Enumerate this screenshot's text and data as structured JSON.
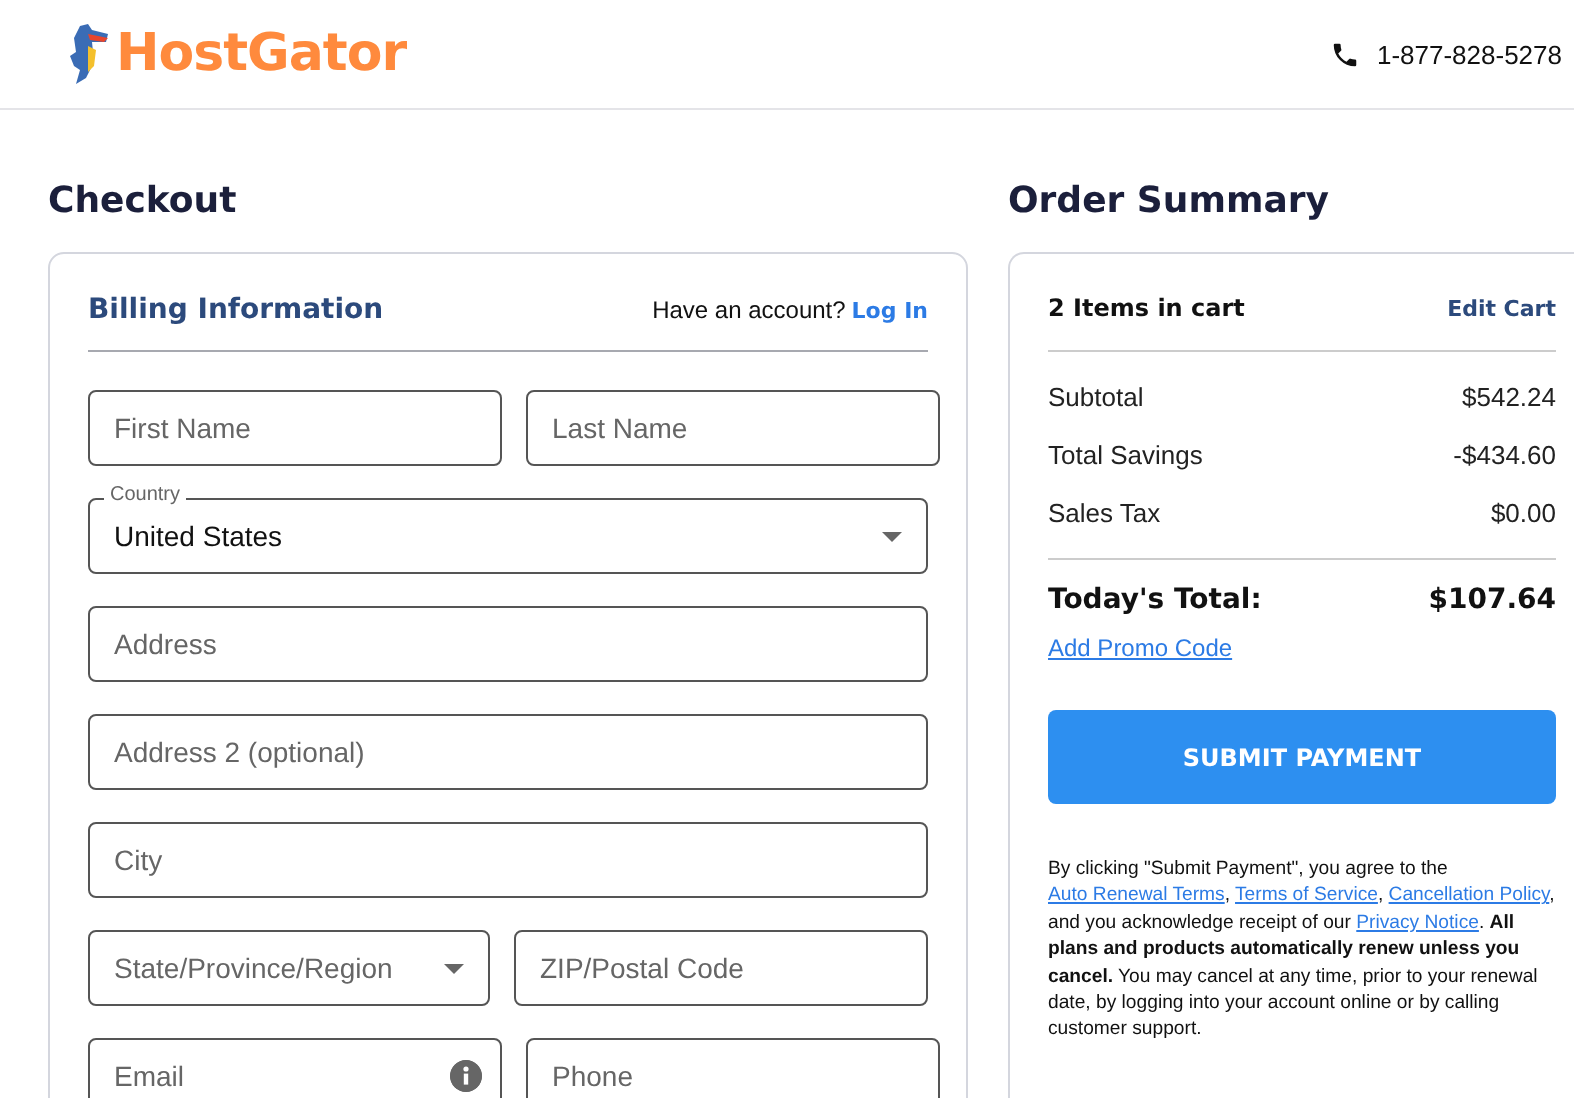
{
  "header": {
    "logo": "HostGator",
    "phone": "1-877-828-5278"
  },
  "checkout": {
    "title": "Checkout",
    "billing_title": "Billing Information",
    "account_prompt": "Have an account?",
    "login_link": "Log In",
    "field_rows": [
      [
        {
          "kind": "text",
          "placeholder": "First Name"
        },
        {
          "kind": "text",
          "placeholder": "Last Name"
        }
      ],
      [
        {
          "kind": "select",
          "label": "Country",
          "value": "United States"
        }
      ],
      [
        {
          "kind": "text",
          "placeholder": "Address"
        }
      ],
      [
        {
          "kind": "text",
          "placeholder": "Address 2 (optional)"
        }
      ],
      [
        {
          "kind": "text",
          "placeholder": "City"
        }
      ],
      [
        {
          "kind": "select",
          "placeholder": "State/Province/Region"
        },
        {
          "kind": "text",
          "placeholder": "ZIP/Postal Code"
        }
      ],
      [
        {
          "kind": "info",
          "placeholder": "Email"
        },
        {
          "kind": "text",
          "placeholder": "Phone"
        }
      ]
    ]
  },
  "order_summary": {
    "title": "Order Summary",
    "items_in_cart": "2 Items in cart",
    "edit_cart": "Edit Cart",
    "lines": [
      {
        "label": "Subtotal",
        "amount": "$542.24"
      },
      {
        "label": "Total Savings",
        "amount": "-$434.60"
      },
      {
        "label": "Sales Tax",
        "amount": "$0.00"
      }
    ],
    "total_label": "Today's Total:",
    "total_amount": "$107.64",
    "promo_link": "Add Promo Code",
    "submit_button": "SUBMIT PAYMENT",
    "legal": [
      {
        "kind": "plain",
        "text": "By clicking \"Submit Payment\", you agree to the "
      },
      {
        "kind": "link",
        "text": "Auto Renewal Terms"
      },
      {
        "kind": "plain",
        "text": ", "
      },
      {
        "kind": "link",
        "text": "Terms of Service"
      },
      {
        "kind": "plain",
        "text": ", "
      },
      {
        "kind": "link",
        "text": "Cancellation Policy"
      },
      {
        "kind": "plain",
        "text": ", and you acknowledge receipt of our "
      },
      {
        "kind": "link",
        "text": "Privacy Notice"
      },
      {
        "kind": "plain",
        "text": ". "
      },
      {
        "kind": "bold",
        "text": "All plans and products automatically renew unless you cancel."
      },
      {
        "kind": "plain",
        "text": " You may cancel at any time, prior to your renewal date, by logging into your account online or by calling customer support."
      }
    ]
  }
}
